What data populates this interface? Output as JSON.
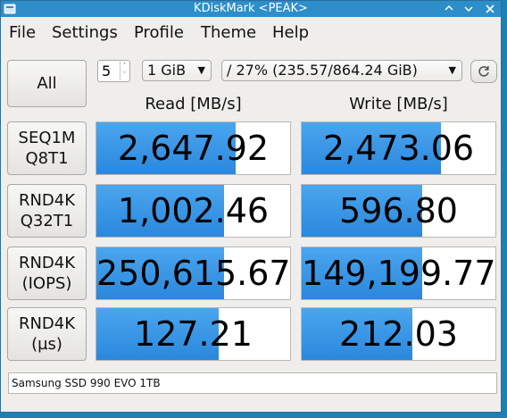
{
  "window": {
    "title": "KDiskMark <PEAK>"
  },
  "menu": [
    "File",
    "Settings",
    "Profile",
    "Theme",
    "Help"
  ],
  "controls": {
    "all_label": "All",
    "runs_value": "5",
    "size_value": "1 GiB",
    "drive_value": "/ 27% (235.57/864.24 GiB)"
  },
  "columns": {
    "read": "Read [MB/s]",
    "write": "Write [MB/s]"
  },
  "rows": [
    {
      "label1": "SEQ1M",
      "label2": "Q8T1",
      "read": "2,647.92",
      "read_fill": 0.72,
      "write": "2,473.06",
      "write_fill": 0.72
    },
    {
      "label1": "RND4K",
      "label2": "Q32T1",
      "read": "1,002.46",
      "read_fill": 0.66,
      "write": "596.80",
      "write_fill": 0.62
    },
    {
      "label1": "RND4K",
      "label2": "(IOPS)",
      "read": "250,615.67",
      "read_fill": 0.66,
      "write": "149,199.77",
      "write_fill": 0.62
    },
    {
      "label1": "RND4K",
      "label2": "(µs)",
      "read": "127.21",
      "read_fill": 0.63,
      "write": "212.03",
      "write_fill": 0.57
    }
  ],
  "status": {
    "device": "Samsung SSD 990 EVO 1TB"
  },
  "colors": {
    "titlebar": "#2d8ec9",
    "bar": "#3b98e6"
  }
}
